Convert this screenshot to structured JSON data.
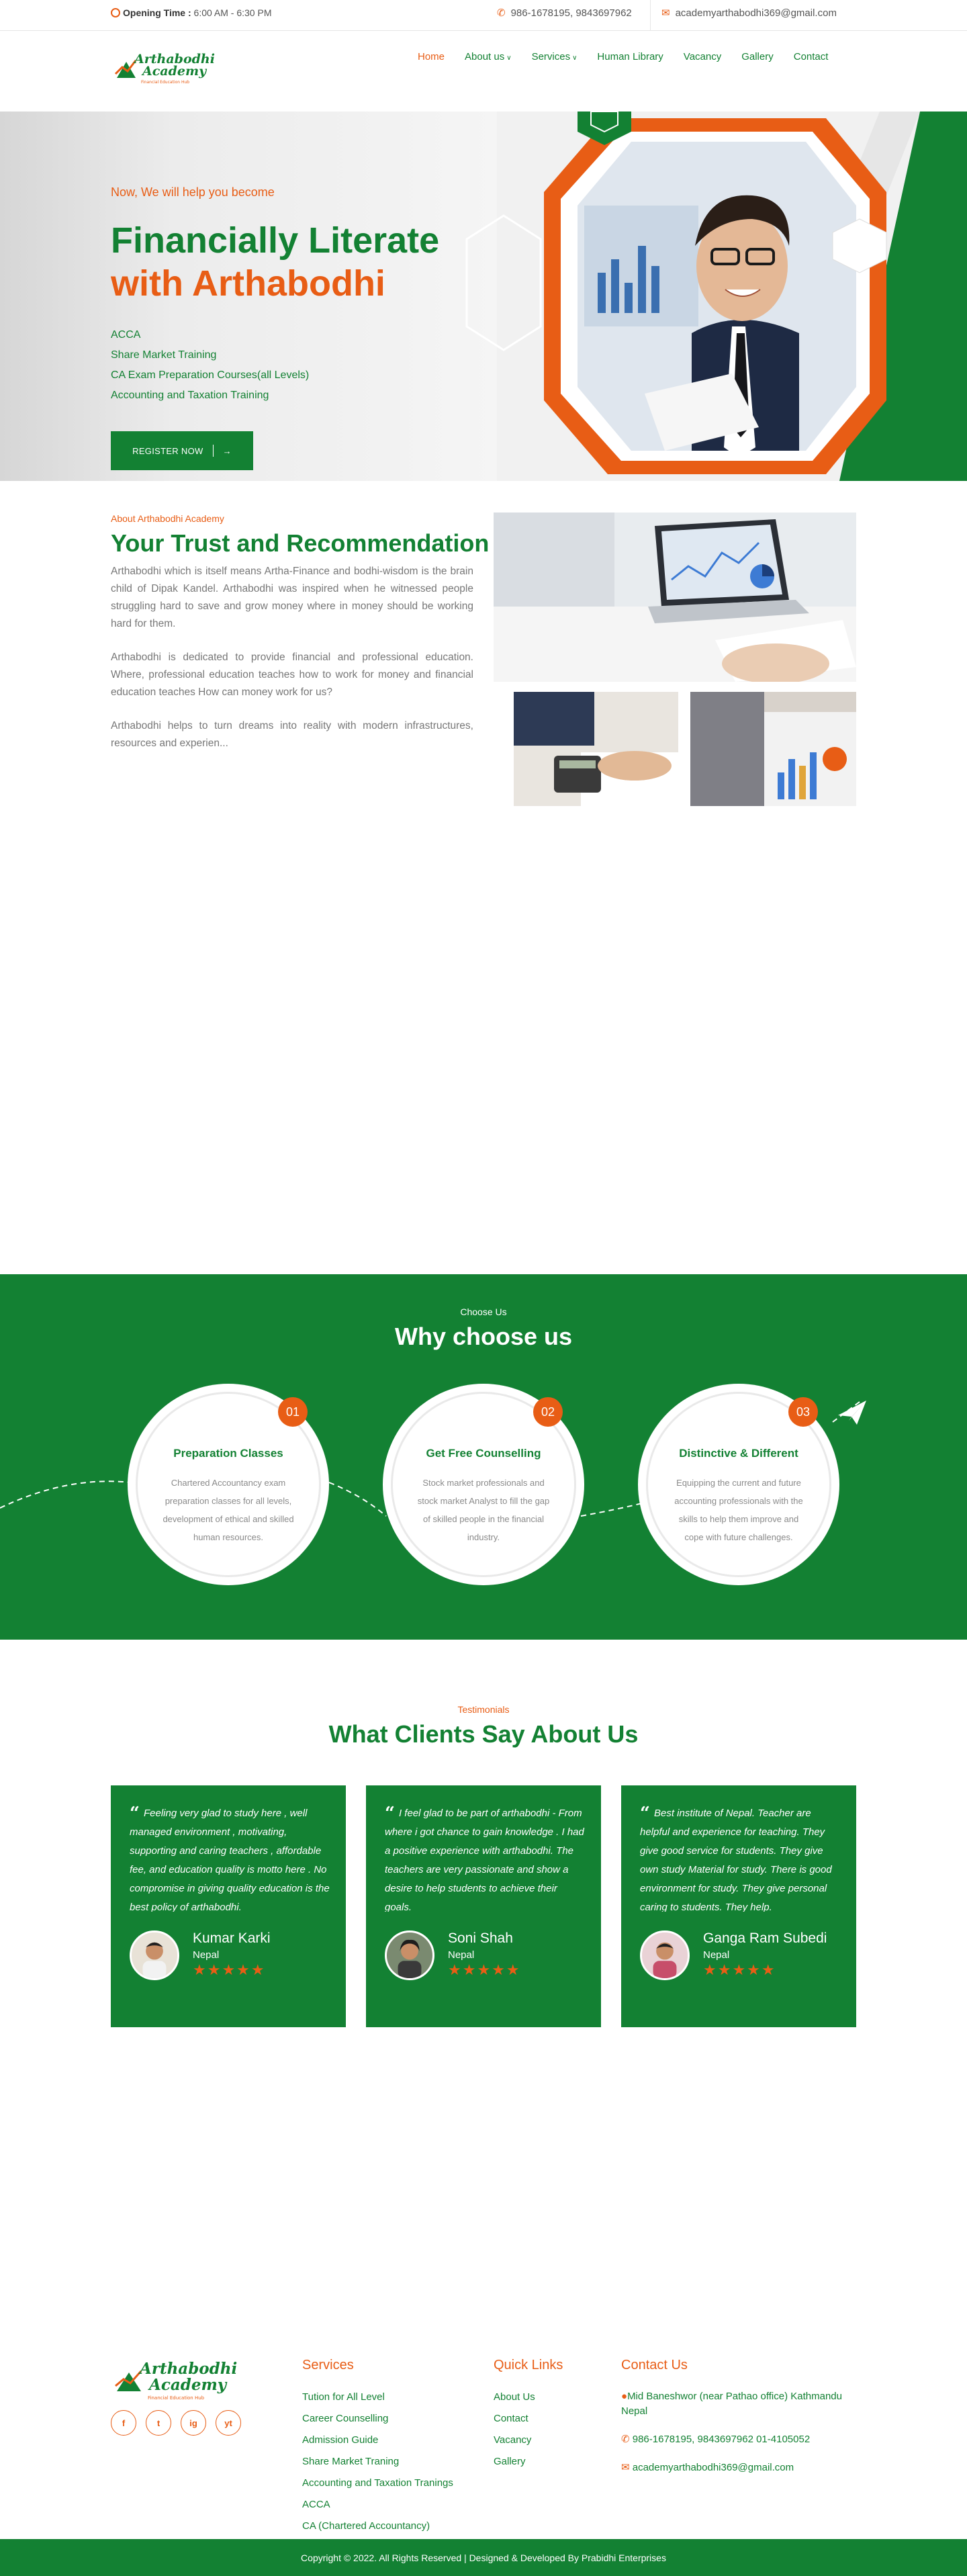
{
  "topbar": {
    "opening_label": "Opening Time :",
    "opening_hours": "6:00 AM - 6:30 PM",
    "phone": "986-1678195, 9843697962",
    "email": "academyarthabodhi369@gmail.com"
  },
  "brand": {
    "name_line1": "Arthabodhi",
    "name_line2": "Academy",
    "tagline": "Financial Education Hub"
  },
  "nav": {
    "home": "Home",
    "about": "About us",
    "services": "Services",
    "library": "Human Library",
    "vacancy": "Vacancy",
    "gallery": "Gallery",
    "contact": "Contact"
  },
  "hero": {
    "tagline": "Now, We will help you become",
    "title_line1": "Financially Literate",
    "title_line2": "with Arthabodhi",
    "courses": [
      "ACCA",
      "Share Market Training",
      "CA Exam Preparation Courses(all Levels)",
      "Accounting and Taxation Training"
    ],
    "cta": "REGISTER NOW"
  },
  "about": {
    "subtitle": "About Arthabodhi Academy",
    "title": "Your Trust and Recommendation",
    "paragraphs": [
      "Arthabodhi which is itself means Artha-Finance and bodhi-wisdom is the brain child of Dipak Kandel. Arthabodhi was inspired when he witnessed people struggling hard to save and grow money where in money should be working hard for them.",
      "Arthabodhi is dedicated to provide financial and professional education. Where, professional education teaches how to work for money and financial education teaches How can money work for us?",
      "Arthabodhi helps to turn dreams into reality with modern infrastructures, resources and experien..."
    ]
  },
  "choose": {
    "subtitle": "Choose Us",
    "title": "Why choose us",
    "items": [
      {
        "num": "01",
        "title": "Preparation Classes",
        "text": "Chartered Accountancy exam preparation classes for all levels, development of ethical and skilled human resources."
      },
      {
        "num": "02",
        "title": "Get Free Counselling",
        "text": "Stock market professionals and stock market Analyst to fill the gap of skilled people in the financial industry."
      },
      {
        "num": "03",
        "title": "Distinctive & Different",
        "text": "Equipping the current and future accounting professionals with the skills to help them improve and cope with future challenges."
      }
    ]
  },
  "testimonials": {
    "subtitle": "Testimonials",
    "title": "What Clients Say About Us",
    "items": [
      {
        "quote": "Feeling very glad to study here , well managed environment , motivating, supporting and caring teachers , affordable fee, and education quality is motto here . No compromise in giving quality education is the best policy of arthabodhi.",
        "name": "Kumar Karki",
        "country": "Nepal",
        "rating": 5
      },
      {
        "quote": "I feel glad to be part of arthabodhi - From where i got chance to gain knowledge . I had a positive experience with arthabodhi. The teachers are very passionate and show a desire to help students to achieve their goals.",
        "name": "Soni Shah",
        "country": "Nepal",
        "rating": 5
      },
      {
        "quote": "Best institute of Nepal. Teacher are helpful and experience for teaching. They give good service for students. They give own study Material for study. There is good environment for study. They give personal caring to students. They help.",
        "name": "Ganga Ram Subedi",
        "country": "Nepal",
        "rating": 5
      }
    ]
  },
  "footer": {
    "social": [
      "f",
      "t",
      "ig",
      "yt"
    ],
    "services_title": "Services",
    "services": [
      "Tution for All Level",
      "Career Counselling",
      "Admission Guide",
      "Share Market Traning",
      "Accounting and Taxation Tranings",
      "ACCA",
      "CA (Chartered Accountancy)"
    ],
    "links_title": "Quick Links",
    "links": [
      "About Us",
      "Contact",
      "Vacancy",
      "Gallery"
    ],
    "contact_title": "Contact Us",
    "address": "Mid Baneshwor (near Pathao office) Kathmandu Nepal",
    "phones": "986-1678195, 9843697962 01-4105052",
    "email": "academyarthabodhi369@gmail.com",
    "copyright": "Copyright © 2022. All Rights Reserved | Designed & Developed By Prabidhi Enterprises"
  },
  "colors": {
    "green": "#138133",
    "orange": "#e85d15"
  }
}
